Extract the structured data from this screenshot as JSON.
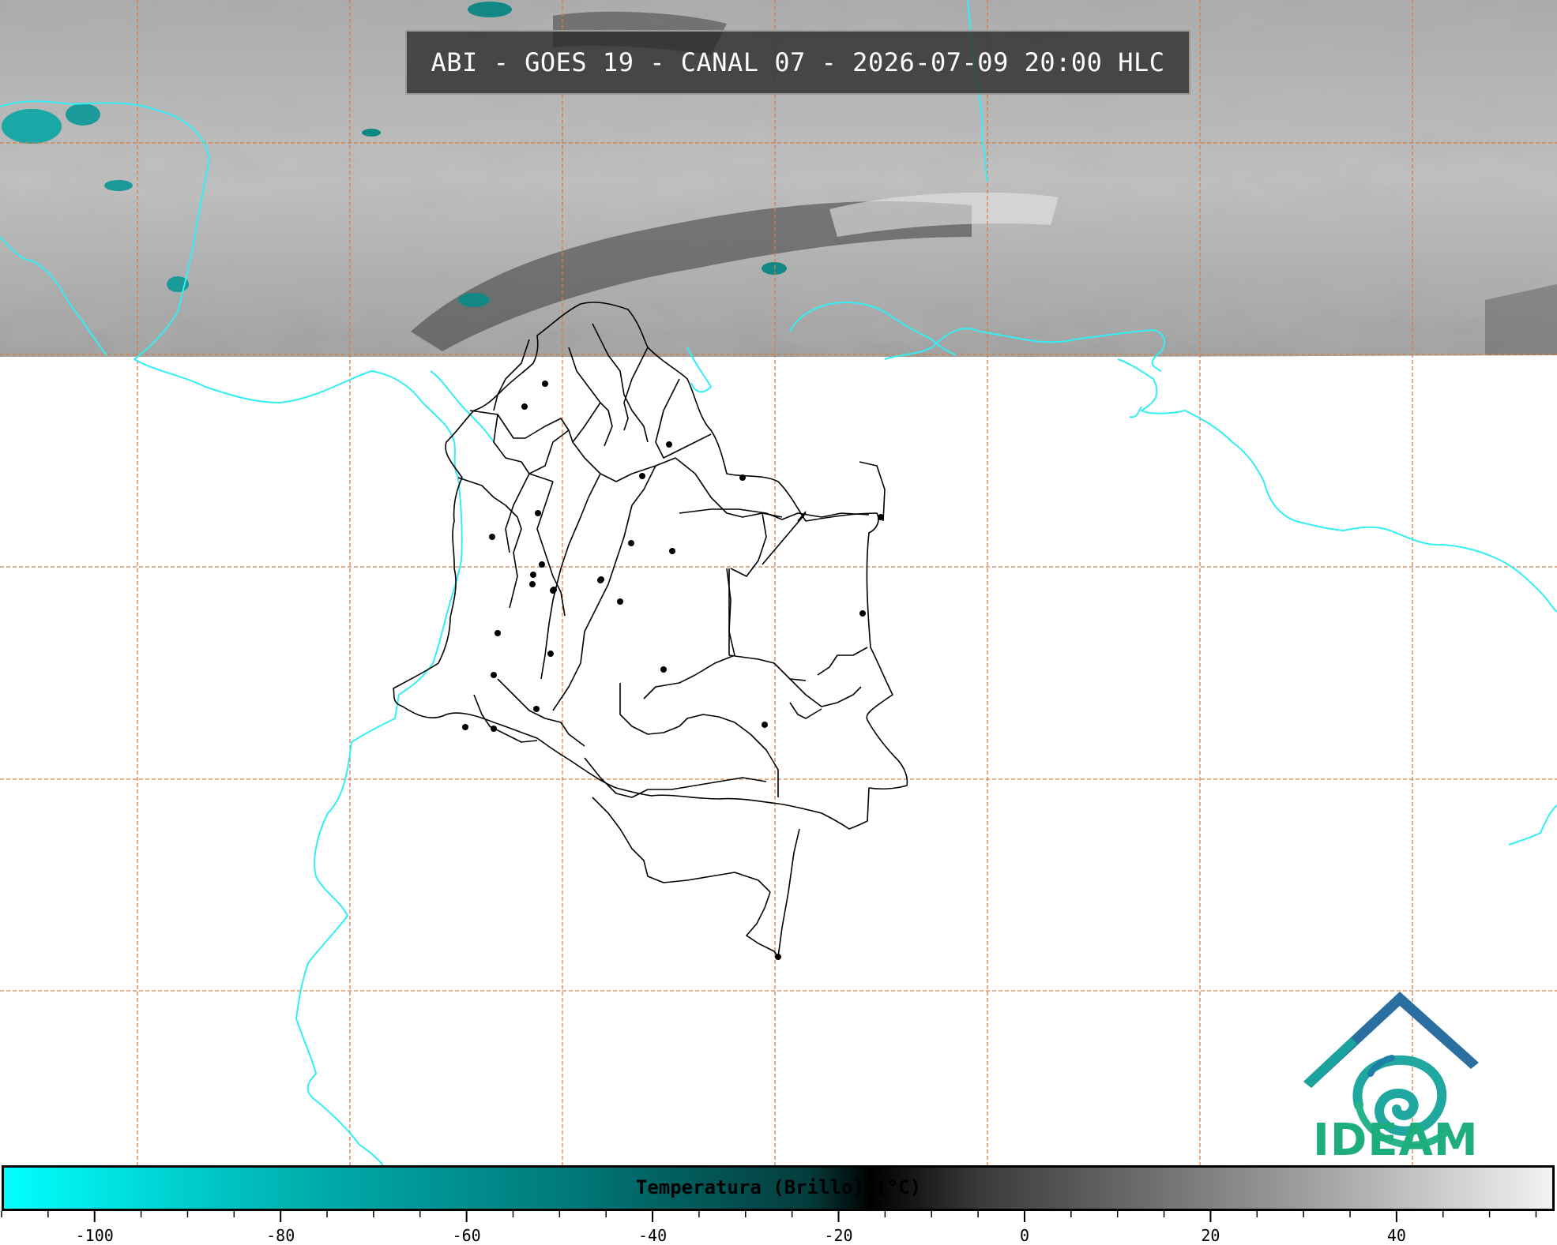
{
  "title": "ABI - GOES 19 - CANAL 07 - 2026-07-09 20:00 HLC",
  "logo": {
    "text": "IDEAM",
    "colors": {
      "roof": "#2a5f9e",
      "swirl": "#1fa7a0",
      "text": "#1ead7f"
    }
  },
  "colorbar": {
    "label": "Temperatura (Brillo) (°C)",
    "tick_labels": [
      "-100",
      "-80",
      "-60",
      "-40",
      "-20",
      "0",
      "20",
      "40"
    ],
    "tick_values": [
      -100,
      -80,
      -60,
      -40,
      -20,
      0,
      20,
      40
    ],
    "range": [
      -110,
      57
    ],
    "colors": {
      "cold": "#00ffff",
      "mid": "#000000",
      "warm": "#f2f2f2"
    }
  },
  "map": {
    "satellite_band_visible": "top strip only",
    "coastline_color": "#33eef5",
    "grid_color": "#d2804a",
    "border_color": "#000000",
    "region_name": "Colombia"
  }
}
